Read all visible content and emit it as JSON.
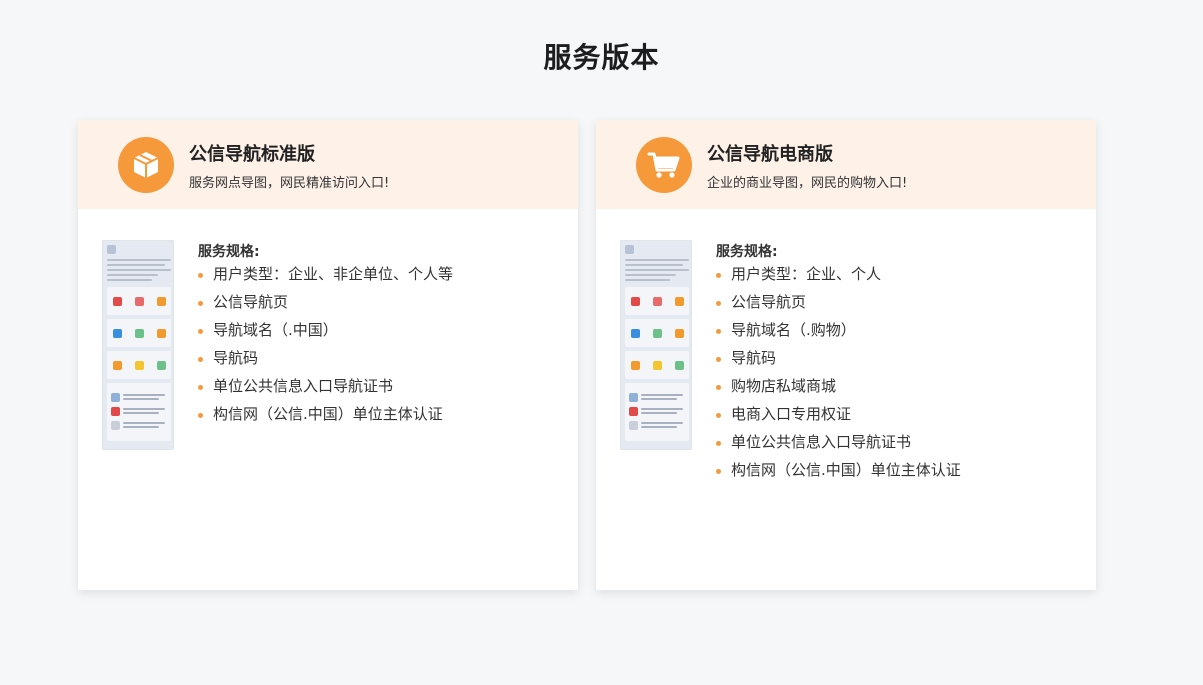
{
  "page": {
    "title": "服务版本"
  },
  "colors": {
    "accent": "#f6993a",
    "header_bg": "#fdf1e8",
    "page_bg": "#f6f7f9"
  },
  "cards": [
    {
      "icon": "box-icon",
      "title": "公信导航标准版",
      "subtitle": "服务网点导图，网民精准访问入口!",
      "spec_title": "服务规格:",
      "specs": [
        "用户类型：企业、非企单位、个人等",
        "公信导航页",
        "导航域名（.中国）",
        "导航码",
        "单位公共信息入口导航证书",
        "构信网（公信.中国）单位主体认证"
      ]
    },
    {
      "icon": "shopping-cart-icon",
      "title": "公信导航电商版",
      "subtitle": "企业的商业导图，网民的购物入口!",
      "spec_title": "服务规格:",
      "specs": [
        "用户类型：企业、个人",
        "公信导航页",
        "导航域名（.购物）",
        "导航码",
        "购物店私域商城",
        "电商入口专用权证",
        "单位公共信息入口导航证书",
        "构信网（公信.中国）单位主体认证"
      ]
    }
  ]
}
